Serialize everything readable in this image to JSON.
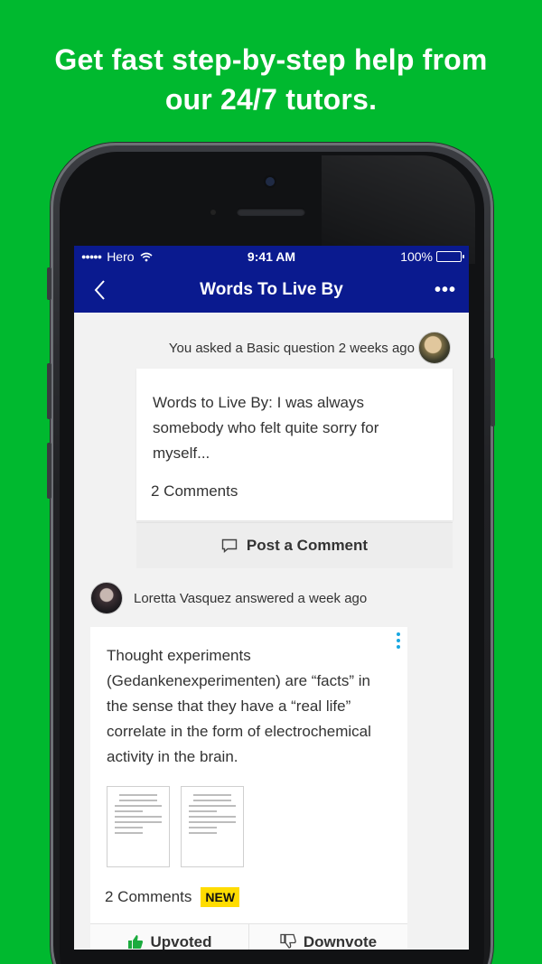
{
  "promo": {
    "line1": "Get fast step-by-step help from",
    "line2": "our 24/7 tutors."
  },
  "status_bar": {
    "carrier": "Hero",
    "time": "9:41 AM",
    "battery": "100%"
  },
  "nav": {
    "title": "Words To Live By"
  },
  "question": {
    "meta": "You asked a Basic question 2 weeks ago",
    "text": "Words to Live By: I was always somebody who felt quite sorry for myself...",
    "comments": "2 Comments",
    "post_comment_label": "Post a Comment"
  },
  "answer": {
    "meta": "Loretta Vasquez answered a week ago",
    "text": "Thought experiments (Gedankenexperimenten) are “facts” in the sense that they have a “real life” correlate in the form of electrochemical activity in the brain.",
    "comments": "2 Comments",
    "badge": "NEW",
    "upvote_label": "Upvoted",
    "downvote_label": "Downvote"
  },
  "colors": {
    "background": "#00b92f",
    "nav": "#0a1a8f",
    "accent": "#18a7e1",
    "badge": "#ffdc00"
  }
}
